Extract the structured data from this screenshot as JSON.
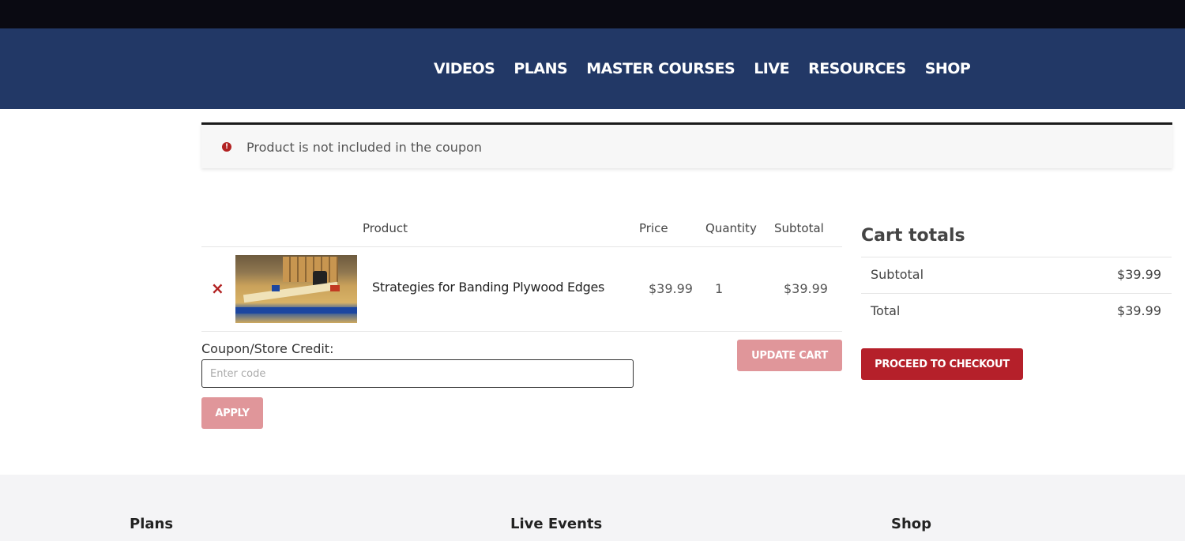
{
  "nav": {
    "items": [
      "VIDEOS",
      "PLANS",
      "MASTER COURSES",
      "LIVE",
      "RESOURCES",
      "SHOP"
    ]
  },
  "notice": {
    "icon": "error-icon",
    "message": "Product is not included in the coupon"
  },
  "cart": {
    "headers": {
      "product": "Product",
      "price": "Price",
      "quantity": "Quantity",
      "subtotal": "Subtotal"
    },
    "items": [
      {
        "name": "Strategies for Banding Plywood Edges",
        "price": "$39.99",
        "quantity": "1",
        "subtotal": "$39.99"
      }
    ],
    "remove_symbol": "×"
  },
  "coupon": {
    "label": "Coupon/Store Credit:",
    "placeholder": "Enter code",
    "value": "",
    "apply_label": "APPLY"
  },
  "update_label": "UPDATE CART",
  "totals": {
    "title": "Cart totals",
    "subtotal_label": "Subtotal",
    "subtotal_value": "$39.99",
    "total_label": "Total",
    "total_value": "$39.99",
    "checkout_label": "PROCEED TO CHECKOUT"
  },
  "footer": {
    "columns": [
      "Plans",
      "Live Events",
      "Shop"
    ]
  },
  "colors": {
    "nav_bg": "#223866",
    "top_bar": "#0a0a12",
    "accent_red": "#b5202a",
    "disabled_red": "#e0969a"
  }
}
